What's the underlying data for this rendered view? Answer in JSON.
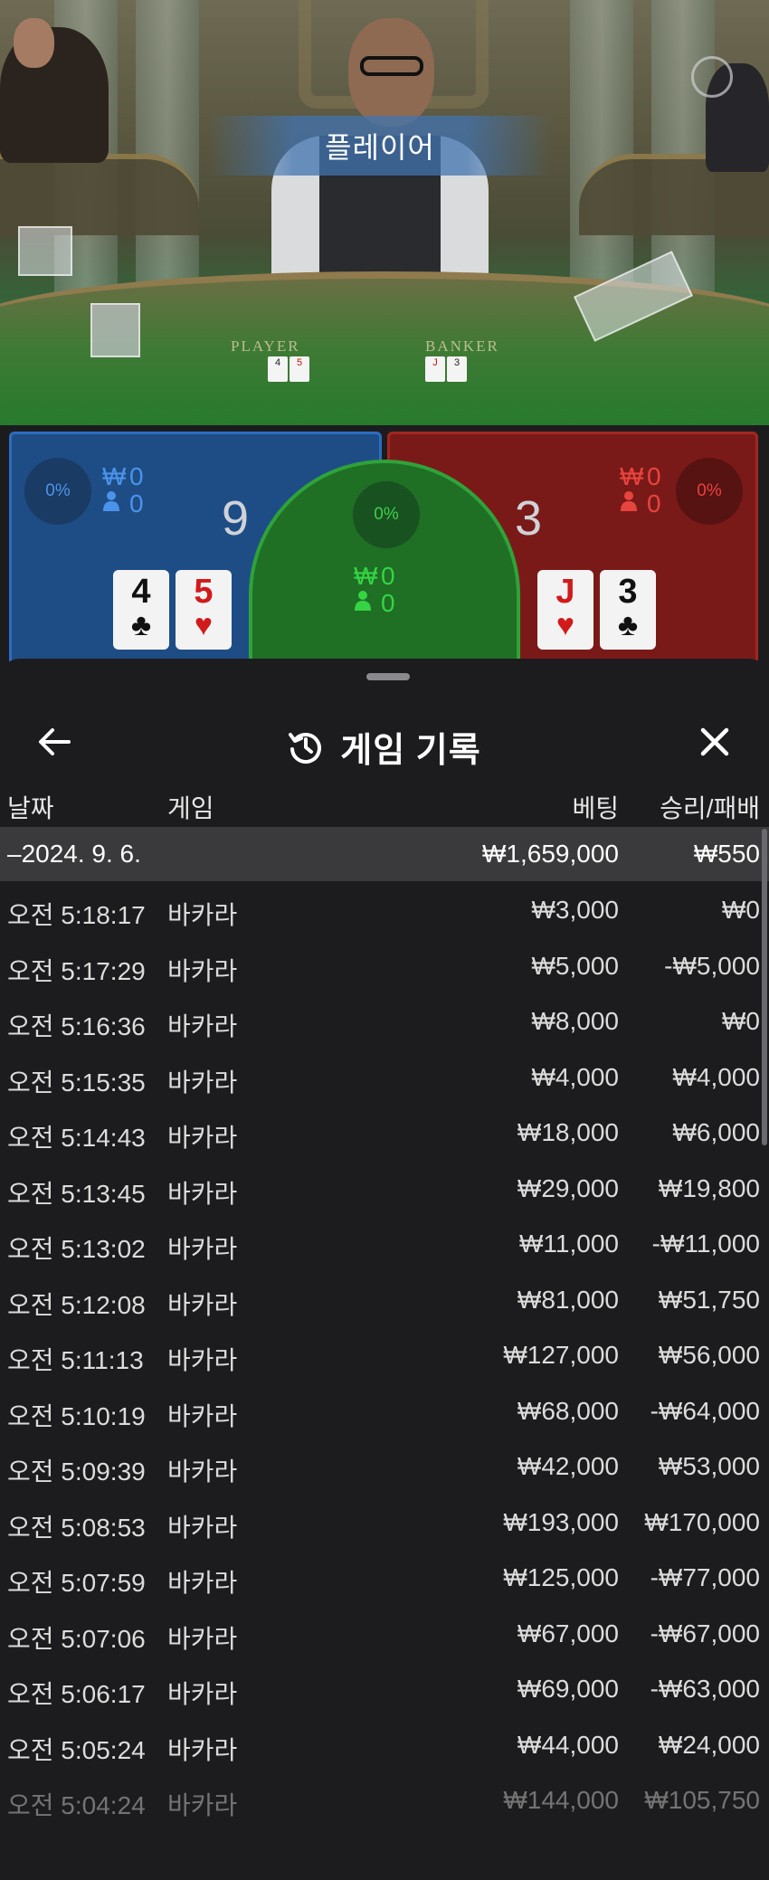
{
  "video": {
    "banner": "플레이어",
    "table_labels": {
      "player": "PLAYER",
      "banker": "BANKER"
    },
    "mini_cards": {
      "player": [
        "4",
        "5"
      ],
      "banker": [
        "J",
        "3"
      ]
    }
  },
  "bet_panels": {
    "player": {
      "percent": "0%",
      "amount": "0",
      "count": "0",
      "score": "9",
      "cards": [
        {
          "rank": "4",
          "suit": "♣",
          "color": "black"
        },
        {
          "rank": "5",
          "suit": "♥",
          "color": "red"
        }
      ]
    },
    "tie": {
      "percent": "0%",
      "amount": "0",
      "count": "0"
    },
    "banker": {
      "percent": "0%",
      "amount": "0",
      "count": "0",
      "score": "3",
      "cards": [
        {
          "rank": "J",
          "suit": "♥",
          "color": "red"
        },
        {
          "rank": "3",
          "suit": "♣",
          "color": "black"
        }
      ]
    },
    "currency_symbol": "₩",
    "colors": {
      "player": "#1e4d86",
      "banker": "#7a1a18",
      "tie": "#1f6f25"
    }
  },
  "history": {
    "title": "게임 기록",
    "columns": {
      "date": "날짜",
      "game": "게임",
      "bet": "베팅",
      "result": "승리/패배"
    },
    "summary": {
      "date": "–2024. 9. 6.",
      "bet": "₩1,659,000",
      "result": "₩550"
    },
    "rows": [
      {
        "time": "오전 5:18:17",
        "game": "바카라",
        "bet": "₩3,000",
        "result": "₩0"
      },
      {
        "time": "오전 5:17:29",
        "game": "바카라",
        "bet": "₩5,000",
        "result": "-₩5,000"
      },
      {
        "time": "오전 5:16:36",
        "game": "바카라",
        "bet": "₩8,000",
        "result": "₩0"
      },
      {
        "time": "오전 5:15:35",
        "game": "바카라",
        "bet": "₩4,000",
        "result": "₩4,000"
      },
      {
        "time": "오전 5:14:43",
        "game": "바카라",
        "bet": "₩18,000",
        "result": "₩6,000"
      },
      {
        "time": "오전 5:13:45",
        "game": "바카라",
        "bet": "₩29,000",
        "result": "₩19,800"
      },
      {
        "time": "오전 5:13:02",
        "game": "바카라",
        "bet": "₩11,000",
        "result": "-₩11,000"
      },
      {
        "time": "오전 5:12:08",
        "game": "바카라",
        "bet": "₩81,000",
        "result": "₩51,750"
      },
      {
        "time": "오전 5:11:13",
        "game": "바카라",
        "bet": "₩127,000",
        "result": "₩56,000"
      },
      {
        "time": "오전 5:10:19",
        "game": "바카라",
        "bet": "₩68,000",
        "result": "-₩64,000"
      },
      {
        "time": "오전 5:09:39",
        "game": "바카라",
        "bet": "₩42,000",
        "result": "₩53,000"
      },
      {
        "time": "오전 5:08:53",
        "game": "바카라",
        "bet": "₩193,000",
        "result": "₩170,000"
      },
      {
        "time": "오전 5:07:59",
        "game": "바카라",
        "bet": "₩125,000",
        "result": "-₩77,000"
      },
      {
        "time": "오전 5:07:06",
        "game": "바카라",
        "bet": "₩67,000",
        "result": "-₩67,000"
      },
      {
        "time": "오전 5:06:17",
        "game": "바카라",
        "bet": "₩69,000",
        "result": "-₩63,000"
      },
      {
        "time": "오전 5:05:24",
        "game": "바카라",
        "bet": "₩44,000",
        "result": "₩24,000"
      },
      {
        "time": "오전 5:04:24",
        "game": "바카라",
        "bet": "₩144,000",
        "result": "₩105,750"
      }
    ],
    "icons": {
      "back": "arrow-left-icon",
      "history": "history-clock-icon",
      "close": "close-icon"
    }
  }
}
